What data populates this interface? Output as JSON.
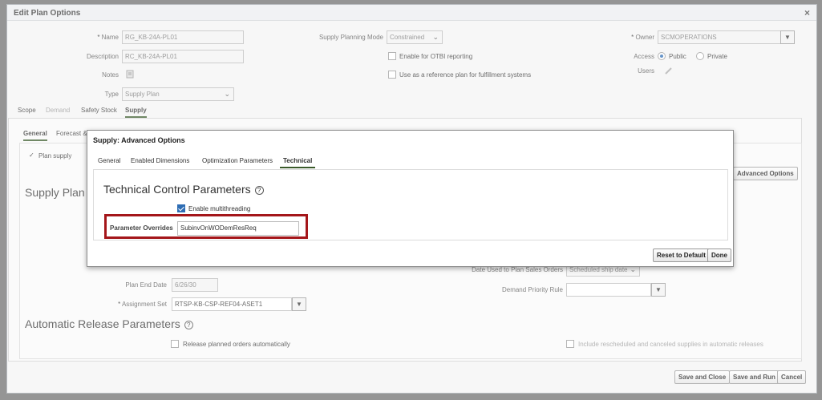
{
  "outer": {
    "title": "Edit Plan Options",
    "close": "×",
    "name_label": "Name",
    "name_value": "RG_KB-24A-PL01",
    "description_label": "Description",
    "description_value": "RC_KB-24A-PL01",
    "notes_label": "Notes",
    "type_label": "Type",
    "type_value": "Supply Plan",
    "spm_label": "Supply Planning Mode",
    "spm_value": "Constrained",
    "otbi_label": "Enable for OTBI reporting",
    "reference_label": "Use as a reference plan for fulfillment systems",
    "owner_label": "Owner",
    "owner_value": "SCMOPERATIONS",
    "access_label": "Access",
    "access_public": "Public",
    "access_private": "Private",
    "users_label": "Users",
    "tabs": [
      "Scope",
      "Demand",
      "Safety Stock",
      "Supply"
    ],
    "subtabs": [
      "General",
      "Forecast &"
    ],
    "plan_supply": "Plan supply",
    "supply_plan_heading": "Supply Plan A",
    "advanced_options_button": "Advanced Options",
    "plan_end_date_label": "Plan End Date",
    "plan_end_date_value": "6/26/30",
    "assignment_set_label": "Assignment Set",
    "assignment_set_value": "RTSP-KB-CSP-REF04-ASET1",
    "date_sales_orders_label": "Date Used to Plan Sales Orders",
    "date_sales_orders_value": "Scheduled ship date",
    "demand_priority_label": "Demand Priority Rule",
    "demand_priority_value": "",
    "auto_release_heading": "Automatic Release Parameters",
    "release_auto_label": "Release planned orders automatically",
    "include_resched_label": "Include rescheduled and canceled supplies in automatic releases",
    "save_close": "Save and Close",
    "save_run": "Save and Run",
    "cancel": "Cancel",
    "help_icon": "?"
  },
  "modal": {
    "title": "Supply: Advanced Options",
    "tabs": [
      "General",
      "Enabled Dimensions",
      "Optimization Parameters",
      "Technical"
    ],
    "active_tab": "Technical",
    "heading": "Technical Control Parameters",
    "multithreading_label": "Enable multithreading",
    "multithreading_checked": true,
    "param_overrides_label": "Parameter Overrides",
    "param_overrides_value": "SubinvOnWODemResReq",
    "reset_button": "Reset to Default",
    "done_button": "Done"
  },
  "colors": {
    "highlight": "#a4161a",
    "accent": "#2e6db4"
  }
}
